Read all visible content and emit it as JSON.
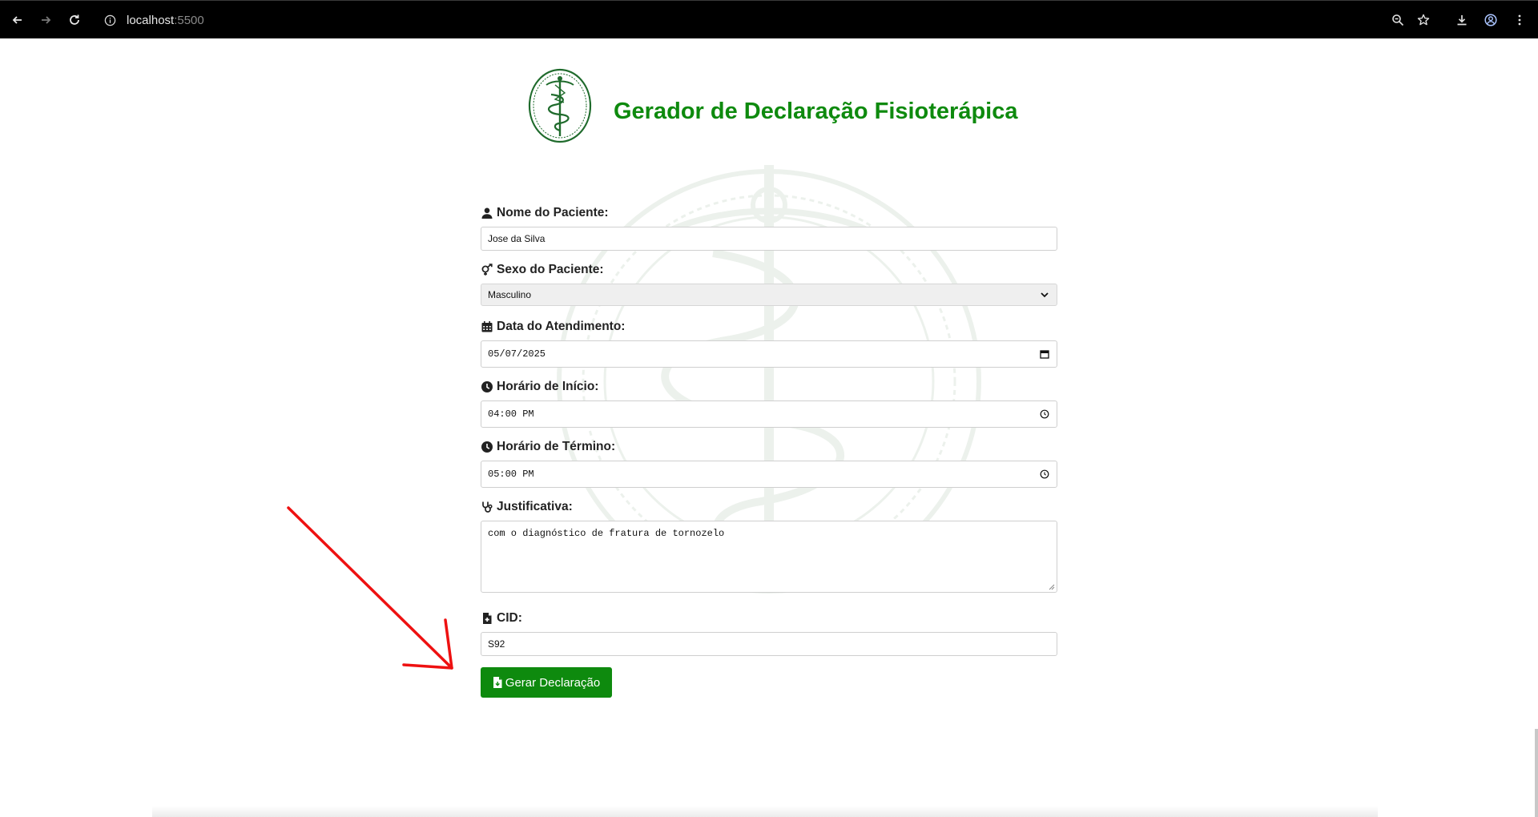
{
  "browser": {
    "url_host": "localhost",
    "url_port": ":5500",
    "icons": {
      "back": "arrow-left-icon",
      "forward": "arrow-right-icon",
      "reload": "reload-icon",
      "site_info": "info-icon",
      "zoom": "zoom-icon",
      "bookmark": "star-icon",
      "download": "download-icon",
      "profile": "profile-icon",
      "menu": "kebab-menu-icon"
    }
  },
  "page": {
    "title": "Gerador de Declaração Fisioterápica",
    "colors": {
      "accent": "#0e8a0e",
      "annotation_arrow": "#ee1111"
    }
  },
  "form": {
    "nome": {
      "label": "Nome do Paciente:",
      "value": "Jose da Silva",
      "icon": "user-icon"
    },
    "sexo": {
      "label": "Sexo do Paciente:",
      "value": "Masculino",
      "icon": "gender-icon"
    },
    "data": {
      "label": "Data do Atendimento:",
      "value": "05/07/2025",
      "icon": "calendar-icon"
    },
    "inicio": {
      "label": "Horário de Início:",
      "value": "04:00 PM",
      "icon": "clock-icon"
    },
    "termino": {
      "label": "Horário de Término:",
      "value": "05:00 PM",
      "icon": "clock-icon"
    },
    "justificativa": {
      "label": "Justificativa:",
      "value": "com o diagnóstico de fratura de tornozelo",
      "icon": "stethoscope-icon"
    },
    "cid": {
      "label": "CID:",
      "value": "S92",
      "icon": "file-medical-icon"
    },
    "submit_label": "Gerar Declaração"
  }
}
